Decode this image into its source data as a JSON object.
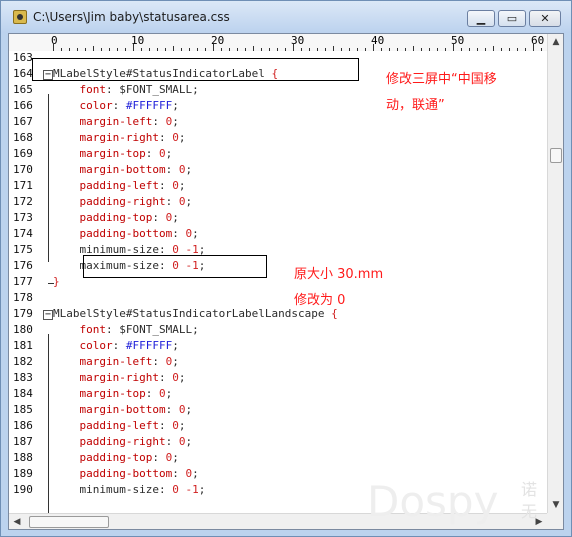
{
  "window": {
    "title": "C:\\Users\\Jim baby\\statusarea.css",
    "buttons": {
      "minimize": "▁",
      "maximize": "▭",
      "close": "✕"
    }
  },
  "ruler": {
    "labels": [
      "0",
      "10",
      "20",
      "30",
      "40",
      "50",
      "60"
    ]
  },
  "code": [
    {
      "num": "163",
      "tokens": []
    },
    {
      "num": "164",
      "fold": "open",
      "tokens": [
        {
          "t": "MLabelStyle#StatusIndicatorLabel ",
          "c": "sel"
        },
        {
          "t": "{",
          "c": "brace"
        }
      ]
    },
    {
      "num": "165",
      "tokens": [
        {
          "t": "    font",
          "c": "prop"
        },
        {
          "t": ": $FONT_SMALL;",
          "c": "sel"
        }
      ]
    },
    {
      "num": "166",
      "tokens": [
        {
          "t": "    color",
          "c": "prop"
        },
        {
          "t": ": ",
          "c": "sel"
        },
        {
          "t": "#FFFFFF",
          "c": "hex"
        },
        {
          "t": ";",
          "c": "sel"
        }
      ]
    },
    {
      "num": "167",
      "tokens": [
        {
          "t": "    margin-left",
          "c": "prop"
        },
        {
          "t": ": ",
          "c": "sel"
        },
        {
          "t": "0",
          "c": "val"
        },
        {
          "t": ";",
          "c": "sel"
        }
      ]
    },
    {
      "num": "168",
      "tokens": [
        {
          "t": "    margin-right",
          "c": "prop"
        },
        {
          "t": ": ",
          "c": "sel"
        },
        {
          "t": "0",
          "c": "val"
        },
        {
          "t": ";",
          "c": "sel"
        }
      ]
    },
    {
      "num": "169",
      "tokens": [
        {
          "t": "    margin-top",
          "c": "prop"
        },
        {
          "t": ": ",
          "c": "sel"
        },
        {
          "t": "0",
          "c": "val"
        },
        {
          "t": ";",
          "c": "sel"
        }
      ]
    },
    {
      "num": "170",
      "tokens": [
        {
          "t": "    margin-bottom",
          "c": "prop"
        },
        {
          "t": ": ",
          "c": "sel"
        },
        {
          "t": "0",
          "c": "val"
        },
        {
          "t": ";",
          "c": "sel"
        }
      ]
    },
    {
      "num": "171",
      "tokens": [
        {
          "t": "    padding-left",
          "c": "prop"
        },
        {
          "t": ": ",
          "c": "sel"
        },
        {
          "t": "0",
          "c": "val"
        },
        {
          "t": ";",
          "c": "sel"
        }
      ]
    },
    {
      "num": "172",
      "tokens": [
        {
          "t": "    padding-right",
          "c": "prop"
        },
        {
          "t": ": ",
          "c": "sel"
        },
        {
          "t": "0",
          "c": "val"
        },
        {
          "t": ";",
          "c": "sel"
        }
      ]
    },
    {
      "num": "173",
      "tokens": [
        {
          "t": "    padding-top",
          "c": "prop"
        },
        {
          "t": ": ",
          "c": "sel"
        },
        {
          "t": "0",
          "c": "val"
        },
        {
          "t": ";",
          "c": "sel"
        }
      ]
    },
    {
      "num": "174",
      "tokens": [
        {
          "t": "    padding-bottom",
          "c": "prop"
        },
        {
          "t": ": ",
          "c": "sel"
        },
        {
          "t": "0",
          "c": "val"
        },
        {
          "t": ";",
          "c": "sel"
        }
      ]
    },
    {
      "num": "175",
      "tokens": [
        {
          "t": "    minimum-size",
          "c": "sel"
        },
        {
          "t": ": ",
          "c": "sel"
        },
        {
          "t": "0 -1",
          "c": "val"
        },
        {
          "t": ";",
          "c": "sel"
        }
      ]
    },
    {
      "num": "176",
      "tokens": [
        {
          "t": "    maximum-size",
          "c": "sel"
        },
        {
          "t": ": ",
          "c": "sel"
        },
        {
          "t": "0 -1",
          "c": "val"
        },
        {
          "t": ";",
          "c": "sel"
        }
      ]
    },
    {
      "num": "177",
      "fold": "end",
      "tokens": [
        {
          "t": "}",
          "c": "brace"
        }
      ]
    },
    {
      "num": "178",
      "tokens": []
    },
    {
      "num": "179",
      "fold": "open",
      "tokens": [
        {
          "t": "MLabelStyle#StatusIndicatorLabelLandscape ",
          "c": "sel"
        },
        {
          "t": "{",
          "c": "brace"
        }
      ]
    },
    {
      "num": "180",
      "tokens": [
        {
          "t": "    font",
          "c": "prop"
        },
        {
          "t": ": $FONT_SMALL;",
          "c": "sel"
        }
      ]
    },
    {
      "num": "181",
      "tokens": [
        {
          "t": "    color",
          "c": "prop"
        },
        {
          "t": ": ",
          "c": "sel"
        },
        {
          "t": "#FFFFFF",
          "c": "hex"
        },
        {
          "t": ";",
          "c": "sel"
        }
      ]
    },
    {
      "num": "182",
      "tokens": [
        {
          "t": "    margin-left",
          "c": "prop"
        },
        {
          "t": ": ",
          "c": "sel"
        },
        {
          "t": "0",
          "c": "val"
        },
        {
          "t": ";",
          "c": "sel"
        }
      ]
    },
    {
      "num": "183",
      "tokens": [
        {
          "t": "    margin-right",
          "c": "prop"
        },
        {
          "t": ": ",
          "c": "sel"
        },
        {
          "t": "0",
          "c": "val"
        },
        {
          "t": ";",
          "c": "sel"
        }
      ]
    },
    {
      "num": "184",
      "tokens": [
        {
          "t": "    margin-top",
          "c": "prop"
        },
        {
          "t": ": ",
          "c": "sel"
        },
        {
          "t": "0",
          "c": "val"
        },
        {
          "t": ";",
          "c": "sel"
        }
      ]
    },
    {
      "num": "185",
      "tokens": [
        {
          "t": "    margin-bottom",
          "c": "prop"
        },
        {
          "t": ": ",
          "c": "sel"
        },
        {
          "t": "0",
          "c": "val"
        },
        {
          "t": ";",
          "c": "sel"
        }
      ]
    },
    {
      "num": "186",
      "tokens": [
        {
          "t": "    padding-left",
          "c": "prop"
        },
        {
          "t": ": ",
          "c": "sel"
        },
        {
          "t": "0",
          "c": "val"
        },
        {
          "t": ";",
          "c": "sel"
        }
      ]
    },
    {
      "num": "187",
      "tokens": [
        {
          "t": "    padding-right",
          "c": "prop"
        },
        {
          "t": ": ",
          "c": "sel"
        },
        {
          "t": "0",
          "c": "val"
        },
        {
          "t": ";",
          "c": "sel"
        }
      ]
    },
    {
      "num": "188",
      "tokens": [
        {
          "t": "    padding-top",
          "c": "prop"
        },
        {
          "t": ": ",
          "c": "sel"
        },
        {
          "t": "0",
          "c": "val"
        },
        {
          "t": ";",
          "c": "sel"
        }
      ]
    },
    {
      "num": "189",
      "tokens": [
        {
          "t": "    padding-bottom",
          "c": "prop"
        },
        {
          "t": ": ",
          "c": "sel"
        },
        {
          "t": "0",
          "c": "val"
        },
        {
          "t": ";",
          "c": "sel"
        }
      ]
    },
    {
      "num": "190",
      "tokens": [
        {
          "t": "    minimum-size",
          "c": "sel"
        },
        {
          "t": ": ",
          "c": "sel"
        },
        {
          "t": "0 -1",
          "c": "val"
        },
        {
          "t": ";",
          "c": "sel"
        }
      ]
    }
  ],
  "annotations": {
    "note1_line1": "修改三屏中“中国移",
    "note1_line2": "动，联通”",
    "note2_line1": "原大小 30.mm",
    "note2_line2": "修改为 0"
  },
  "watermark": {
    "text": "Dospy",
    "cn_line1": "诺",
    "cn_line2": "无"
  },
  "colors": {
    "annotation": "#ff1a1a",
    "property": "#c00000",
    "hex_value": "#1f1fd9"
  },
  "icons": {
    "app": "file-icon",
    "scroll_up": "▲",
    "scroll_down": "▼",
    "scroll_left": "◀",
    "scroll_right": "▶"
  }
}
